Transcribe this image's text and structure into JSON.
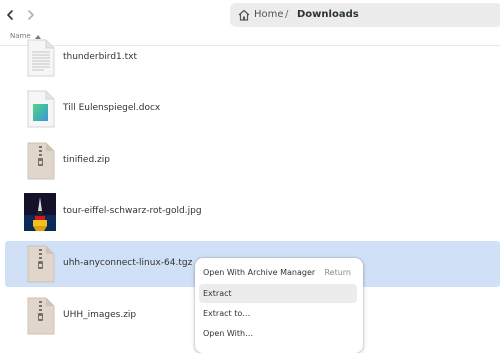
{
  "toolbar": {
    "back_icon": "chevron-left-icon",
    "forward_icon": "chevron-right-icon"
  },
  "pathbar": {
    "home_label": "Home",
    "separator": "/",
    "current": "Downloads"
  },
  "header": {
    "name_label": "Name",
    "sort": "ascending"
  },
  "files": [
    {
      "name": "thunderbird1.txt",
      "icon": "text-file-icon"
    },
    {
      "name": "Till Eulenspiegel.docx",
      "icon": "document-file-icon"
    },
    {
      "name": "tinified.zip",
      "icon": "archive-file-icon"
    },
    {
      "name": "tour-eiffel-schwarz-rot-gold.jpg",
      "icon": "image-thumbnail-icon"
    },
    {
      "name": "uhh-anyconnect-linux-64.tgz",
      "icon": "archive-file-icon",
      "selected": true
    },
    {
      "name": "UHH_images.zip",
      "icon": "archive-file-icon"
    }
  ],
  "context_menu": {
    "items": [
      {
        "label": "Open With Archive Manager",
        "accel": "Return"
      },
      {
        "label": "Extract",
        "hover": true
      },
      {
        "label": "Extract to…"
      },
      {
        "label": "Open With…"
      }
    ]
  },
  "colors": {
    "selection": "#cfe0f7",
    "menu_hover": "#ececec",
    "pathbar": "#ececec"
  }
}
